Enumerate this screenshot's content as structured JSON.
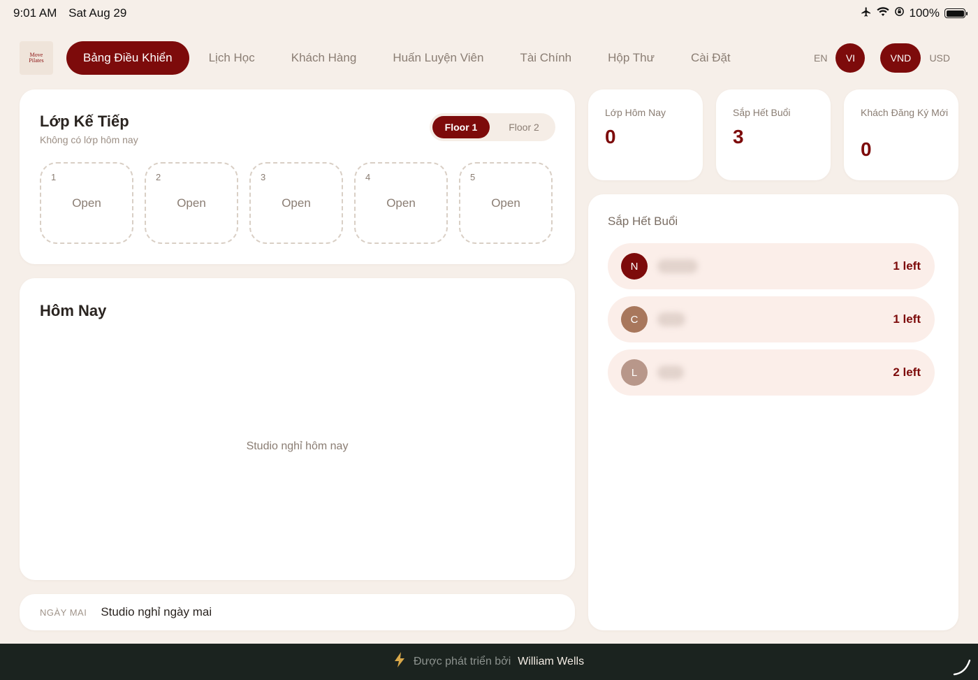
{
  "status_bar": {
    "time": "9:01 AM",
    "date": "Sat Aug 29",
    "battery": "100%",
    "icons": [
      "airplane-icon",
      "wifi-icon",
      "orientation-lock-icon",
      "battery-icon"
    ]
  },
  "nav": {
    "logo_line1": "Move",
    "logo_line2": "Pilates",
    "tabs": [
      {
        "label": "Bảng Điều Khiển",
        "active": true
      },
      {
        "label": "Lịch Học",
        "active": false
      },
      {
        "label": "Khách Hàng",
        "active": false
      },
      {
        "label": "Huấn Luyện Viên",
        "active": false
      },
      {
        "label": "Tài Chính",
        "active": false
      },
      {
        "label": "Hộp Thư",
        "active": false
      },
      {
        "label": "Cài Đặt",
        "active": false
      }
    ],
    "languages": [
      {
        "label": "EN",
        "active": false
      },
      {
        "label": "VI",
        "active": true
      }
    ],
    "currencies": [
      {
        "label": "VND",
        "active": true
      },
      {
        "label": "USD",
        "active": false
      }
    ]
  },
  "next_class": {
    "title": "Lớp Kế Tiếp",
    "subtitle": "Không có lớp hôm nay",
    "floors": [
      {
        "label": "Floor 1",
        "active": true
      },
      {
        "label": "Floor 2",
        "active": false
      }
    ],
    "slots": [
      {
        "number": "1",
        "label": "Open"
      },
      {
        "number": "2",
        "label": "Open"
      },
      {
        "number": "3",
        "label": "Open"
      },
      {
        "number": "4",
        "label": "Open"
      },
      {
        "number": "5",
        "label": "Open"
      }
    ]
  },
  "today": {
    "title": "Hôm Nay",
    "empty_message": "Studio nghỉ hôm nay"
  },
  "tomorrow": {
    "label": "NGÀY MAI",
    "text": "Studio nghỉ ngày mai"
  },
  "stats": [
    {
      "label": "Lớp Hôm Nay",
      "value": "0"
    },
    {
      "label": "Sắp Hết Buổi",
      "value": "3"
    },
    {
      "label": "Khách Đăng Ký Mới",
      "value": "0"
    }
  ],
  "expiring": {
    "title": "Sắp Hết Buổi",
    "rows": [
      {
        "initial": "N",
        "color": "#7d0b0b",
        "remaining": "1 left"
      },
      {
        "initial": "C",
        "color": "#a8775c",
        "remaining": "1 left"
      },
      {
        "initial": "L",
        "color": "#b8978a",
        "remaining": "2 left"
      }
    ]
  },
  "footer": {
    "text": "Được phát triển bởi",
    "name": "William Wells"
  },
  "colors": {
    "accent": "#7d0b0b",
    "background": "#f6efe9",
    "footer": "#1b231f"
  }
}
